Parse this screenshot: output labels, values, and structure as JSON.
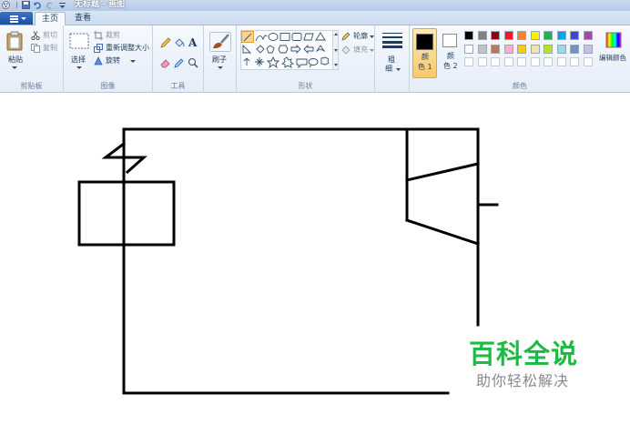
{
  "window": {
    "title": "无标题 - 画图"
  },
  "tabs": {
    "home": "主页",
    "view": "查看"
  },
  "clipboard": {
    "paste": "粘贴",
    "cut": "剪切",
    "copy": "复制",
    "group": "剪贴板"
  },
  "image": {
    "select": "选择",
    "crop": "裁剪",
    "resize": "重新调整大小",
    "rotate": "旋转",
    "group": "图像"
  },
  "tools": {
    "group": "工具",
    "text_glyph": "A"
  },
  "brushes": {
    "label": "刷子"
  },
  "shapes": {
    "outline": "轮廓",
    "fill": "填充",
    "group": "形状"
  },
  "size": {
    "label1": "粗",
    "label2": "细"
  },
  "colors": {
    "color1_l1": "颜",
    "color1_l2": "色 1",
    "color2_l1": "颜",
    "color2_l2": "色 2",
    "edit": "编辑颜色",
    "group": "颜色",
    "row1": [
      "#000000",
      "#7f7f7f",
      "#880015",
      "#ed1c24",
      "#ff7f27",
      "#fff200",
      "#22b14c",
      "#00a2e8",
      "#3f48cc",
      "#a349a4"
    ],
    "row2": [
      "#ffffff",
      "#c3c3c3",
      "#b97a57",
      "#ffaec9",
      "#ffc90e",
      "#efe4b0",
      "#b5e61d",
      "#99d9ea",
      "#7092be",
      "#c8bfe7"
    ]
  },
  "watermark": {
    "title": "百科全说",
    "subtitle": "助你轻松解决"
  }
}
